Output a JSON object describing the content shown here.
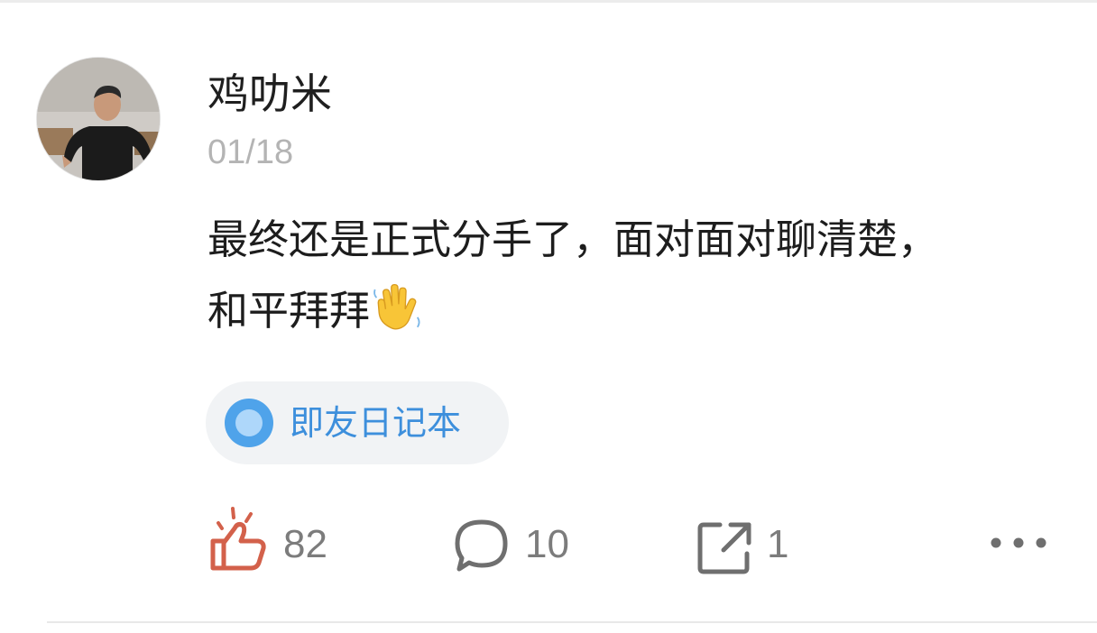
{
  "post": {
    "author": "鸡叻米",
    "date": "01/18",
    "text_line1": "最终还是正式分手了，面对面对聊清楚，",
    "text_line2": "和平拜拜",
    "emoji": "waving-hand-icon"
  },
  "topic": {
    "label": "即友日记本",
    "icon": "topic-dot-icon"
  },
  "actions": {
    "like": {
      "count": "82",
      "icon": "thumbs-up-icon",
      "color": "#d3614b"
    },
    "comment": {
      "count": "10",
      "icon": "comment-bubble-icon"
    },
    "share": {
      "count": "1",
      "icon": "share-icon"
    },
    "more": {
      "icon": "more-dots-icon"
    }
  },
  "colors": {
    "accent_blue": "#3d8fdc",
    "like_red": "#d3614b",
    "muted_gray": "#7c7c7c"
  }
}
